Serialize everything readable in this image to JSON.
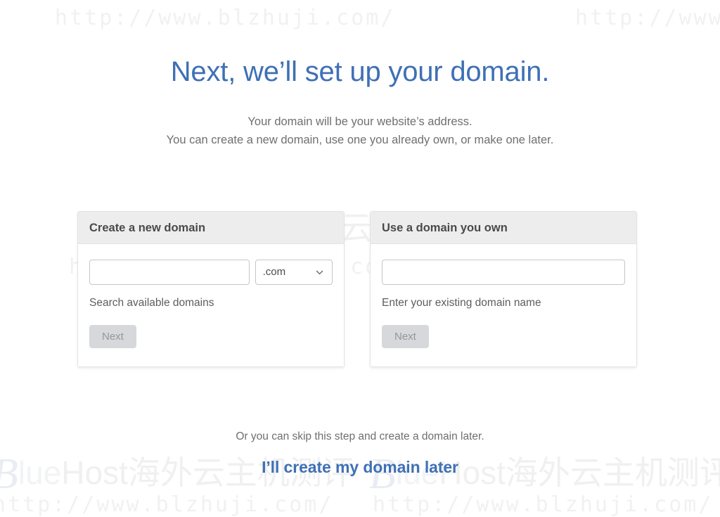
{
  "page": {
    "title": "Next, we’ll set up your domain.",
    "subtitle_line1": "Your domain will be your website’s address.",
    "subtitle_line2": "You can create a new domain, use one you already own, or make one later.",
    "title_color": "#3f70b5"
  },
  "cards": {
    "create": {
      "header": "Create a new domain",
      "input_value": "",
      "input_placeholder": "",
      "tld_selected": ".com",
      "helper": "Search available domains",
      "next_label": "Next",
      "next_disabled": true
    },
    "own": {
      "header": "Use a domain you own",
      "input_value": "",
      "input_placeholder": "",
      "helper": "Enter your existing domain name",
      "next_label": "Next",
      "next_disabled": true
    }
  },
  "footer": {
    "skip_text": "Or you can skip this step and create a domain later.",
    "skip_link": "I’ll create my domain later",
    "link_color": "#3f70b5"
  },
  "watermarks": {
    "url": "http://www.blzhuji.com/",
    "brand_b": "B",
    "brand_lue": "lue",
    "brand_rest": "Host海外云主机测评",
    "color": "#f1f1f1"
  },
  "icons": {
    "chevron_down": "chevron-down-icon"
  }
}
